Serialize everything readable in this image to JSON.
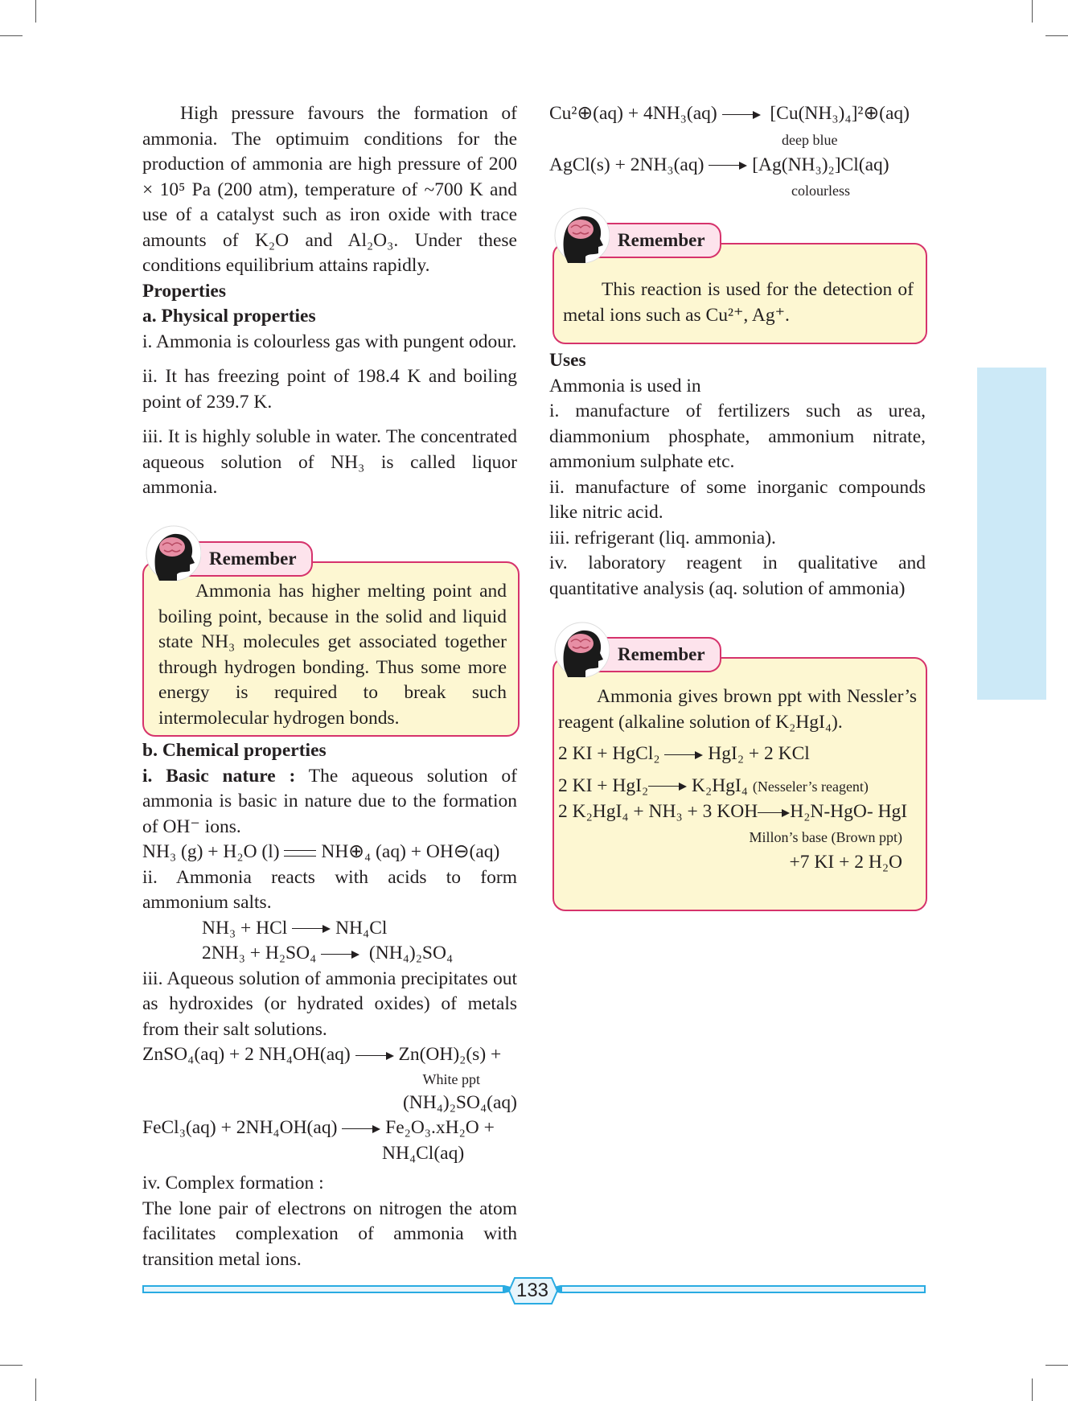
{
  "left": {
    "intro": "High pressure favours the formation of ammonia. The optimuim conditions for the production of ammonia are high pressure of 200 × 10⁵ Pa (200 atm), temperature of ~700 K and use of a catalyst such as iron oxide with trace amounts of K₂O and Al₂O₃. Under these conditions equilibrium attains rapidly.",
    "properties_heading": "Properties",
    "physical_heading": "a. Physical properties",
    "phys1": "i. Ammonia is colourless gas with pungent odour.",
    "phys2": "ii. It has freezing point of 198.4 K and boiling point of 239.7 K.",
    "phys3": "iii. It is highly soluble in water. The concentrated aqueous solution of NH₃ is called liquor ammonia.",
    "remember_label": "Remember",
    "remember_text": "Ammonia has higher melting point and boiling point, because in the solid and liquid state NH₃ molecules get associated together through hydrogen bonding. Thus some more energy is required to break such intermolecular hydrogen bonds.",
    "chemical_heading": "b. Chemical properties",
    "basic_label": "i. Basic nature :",
    "basic_text": "The aqueous solution of ammonia is basic in nature due to the formation of OH⁻ ions.",
    "eq1_left": "NH₃ (g) + H₂O (l)",
    "eq1_right": "NH⊕₄ (aq) + OH⊖(aq)",
    "acids_text": "ii. Ammonia reacts with acids to form ammonium salts.",
    "eq2_left": "NH₃ + HCl",
    "eq2_right": "NH₄Cl",
    "eq3_left": "2NH₃ + H₂SO₄",
    "eq3_right": "(NH₄)₂SO₄",
    "precip_text": "iii. Aqueous solution of ammonia precipitates out as hydroxides (or hydrated oxides) of metals from their salt solutions.",
    "eq4_left": "ZnSO₄(aq) + 2 NH₄OH(aq)",
    "eq4_right": "Zn(OH)₂(s) +",
    "eq4_note": "White ppt",
    "eq4_cont": "(NH₄)₂SO₄(aq)",
    "eq5_left": "FeCl₃(aq) + 2NH₄OH(aq)",
    "eq5_right": "Fe₂O₃.xH₂O +",
    "eq5_cont": "NH₄Cl(aq)",
    "complex_heading": "iv. Complex formation :",
    "complex_text": "The lone pair of electrons on nitrogen the atom facilitates complexation of ammonia with transition metal ions."
  },
  "right": {
    "eq6_left": "Cu²⊕(aq) + 4NH₃(aq)",
    "eq6_right": "[Cu(NH₃)₄]²⊕(aq)",
    "eq6_note": "deep blue",
    "eq7_left": "AgCl(s) + 2NH₃(aq)",
    "eq7_right": "[Ag(NH₃)₂]Cl(aq)",
    "eq7_note": "colourless",
    "remember1_label": "Remember",
    "remember1_text": "This reaction is used for the detection of metal ions such as Cu²⁺, Ag⁺.",
    "uses_heading": "Uses",
    "uses_intro": "Ammonia is used in",
    "use1": "i. manufacture of fertilizers such as urea, diammonium phosphate, ammonium nitrate, ammonium sulphate etc.",
    "use2": "ii. manufacture of some inorganic compounds like nitric acid.",
    "use3": "iii. refrigerant (liq. ammonia).",
    "use4": "iv. laboratory reagent in qualitative and quantitative analysis (aq. solution of ammonia)",
    "remember2_label": "Remember",
    "remember2_text": "Ammonia gives brown ppt with Nessler’s reagent (alkaline solution of K₂HgI₄).",
    "eq8_left": "2 KI + HgCl₂",
    "eq8_right": "HgI₂ + 2 KCl",
    "eq9_left": "2 KI + HgI₂",
    "eq9_right": "K₂HgI₄",
    "eq9_note": "(Nesseler’s reagent)",
    "eq10_left": "2 K₂HgI₄ + NH₃ + 3 KOH",
    "eq10_right": "H₂N-HgO- HgI",
    "eq10_note": "Millon’s base (Brown ppt)",
    "eq10_cont": "+7 KI + 2 H₂O"
  },
  "page_number": "133",
  "colors": {
    "accent_pink": "#d6336c",
    "box_fill": "#fdf7d2",
    "tag_fill": "#fde3ec",
    "tab_blue": "#cce9f7",
    "footer_blue": "#29abe2"
  }
}
